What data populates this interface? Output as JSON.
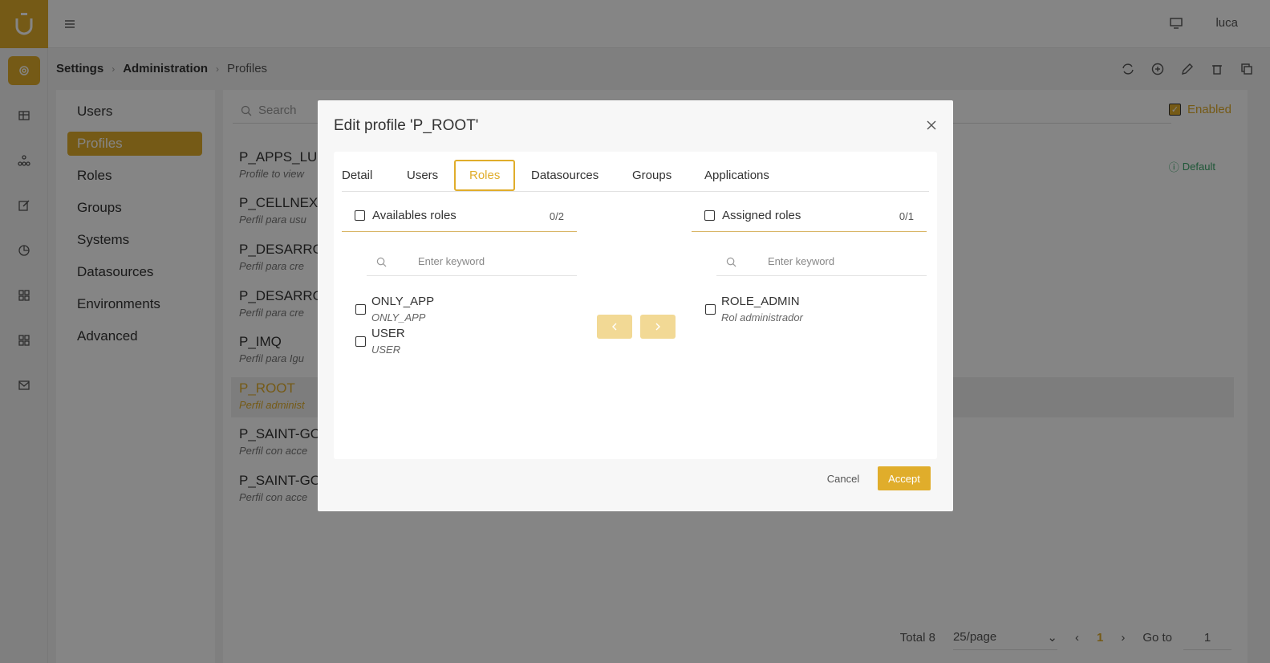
{
  "topbar": {
    "user": "luca"
  },
  "breadcrumb": {
    "level1": "Settings",
    "level2": "Administration",
    "current": "Profiles"
  },
  "leftnav": {
    "items": [
      {
        "label": "Users"
      },
      {
        "label": "Profiles",
        "active": true
      },
      {
        "label": "Roles"
      },
      {
        "label": "Groups"
      },
      {
        "label": "Systems"
      },
      {
        "label": "Datasources"
      },
      {
        "label": "Environments"
      },
      {
        "label": "Advanced"
      }
    ]
  },
  "content": {
    "search_placeholder": "Search",
    "enabled_label": "Enabled",
    "default_label": "Default",
    "profiles": [
      {
        "name": "P_APPS_LU",
        "desc": "Profile to view"
      },
      {
        "name": "P_CELLNEX",
        "desc": "Perfil para usu"
      },
      {
        "name": "P_DESARRO",
        "desc": "Perfil para cre"
      },
      {
        "name": "P_DESARRO",
        "desc": "Perfil para cre"
      },
      {
        "name": "P_IMQ",
        "desc": "Perfil para Igu"
      },
      {
        "name": "P_ROOT",
        "desc": "Perfil administ",
        "selected": true
      },
      {
        "name": "P_SAINT-GO",
        "desc": "Perfil con acce"
      },
      {
        "name": "P_SAINT-GO",
        "desc": "Perfil con acce"
      }
    ]
  },
  "pager": {
    "total": "Total 8",
    "page_size": "25/page",
    "current_page": "1",
    "goto_label": "Go to",
    "goto_value": "1"
  },
  "modal": {
    "title": "Edit profile 'P_ROOT'",
    "tabs": [
      "Detail",
      "Users",
      "Roles",
      "Datasources",
      "Groups",
      "Applications"
    ],
    "active_tab": "Roles",
    "available": {
      "title": "Availables roles",
      "count": "0/2",
      "search_placeholder": "Enter keyword",
      "items": [
        {
          "name": "ONLY_APP",
          "desc": "ONLY_APP"
        },
        {
          "name": "USER",
          "desc": "USER"
        }
      ]
    },
    "assigned": {
      "title": "Assigned roles",
      "count": "0/1",
      "search_placeholder": "Enter keyword",
      "items": [
        {
          "name": "ROLE_ADMIN",
          "desc": "Rol administrador"
        }
      ]
    },
    "cancel_label": "Cancel",
    "accept_label": "Accept"
  },
  "colors": {
    "accent": "#e0ad2b",
    "accent_light": "#f2d995",
    "success": "#3aa66a"
  }
}
